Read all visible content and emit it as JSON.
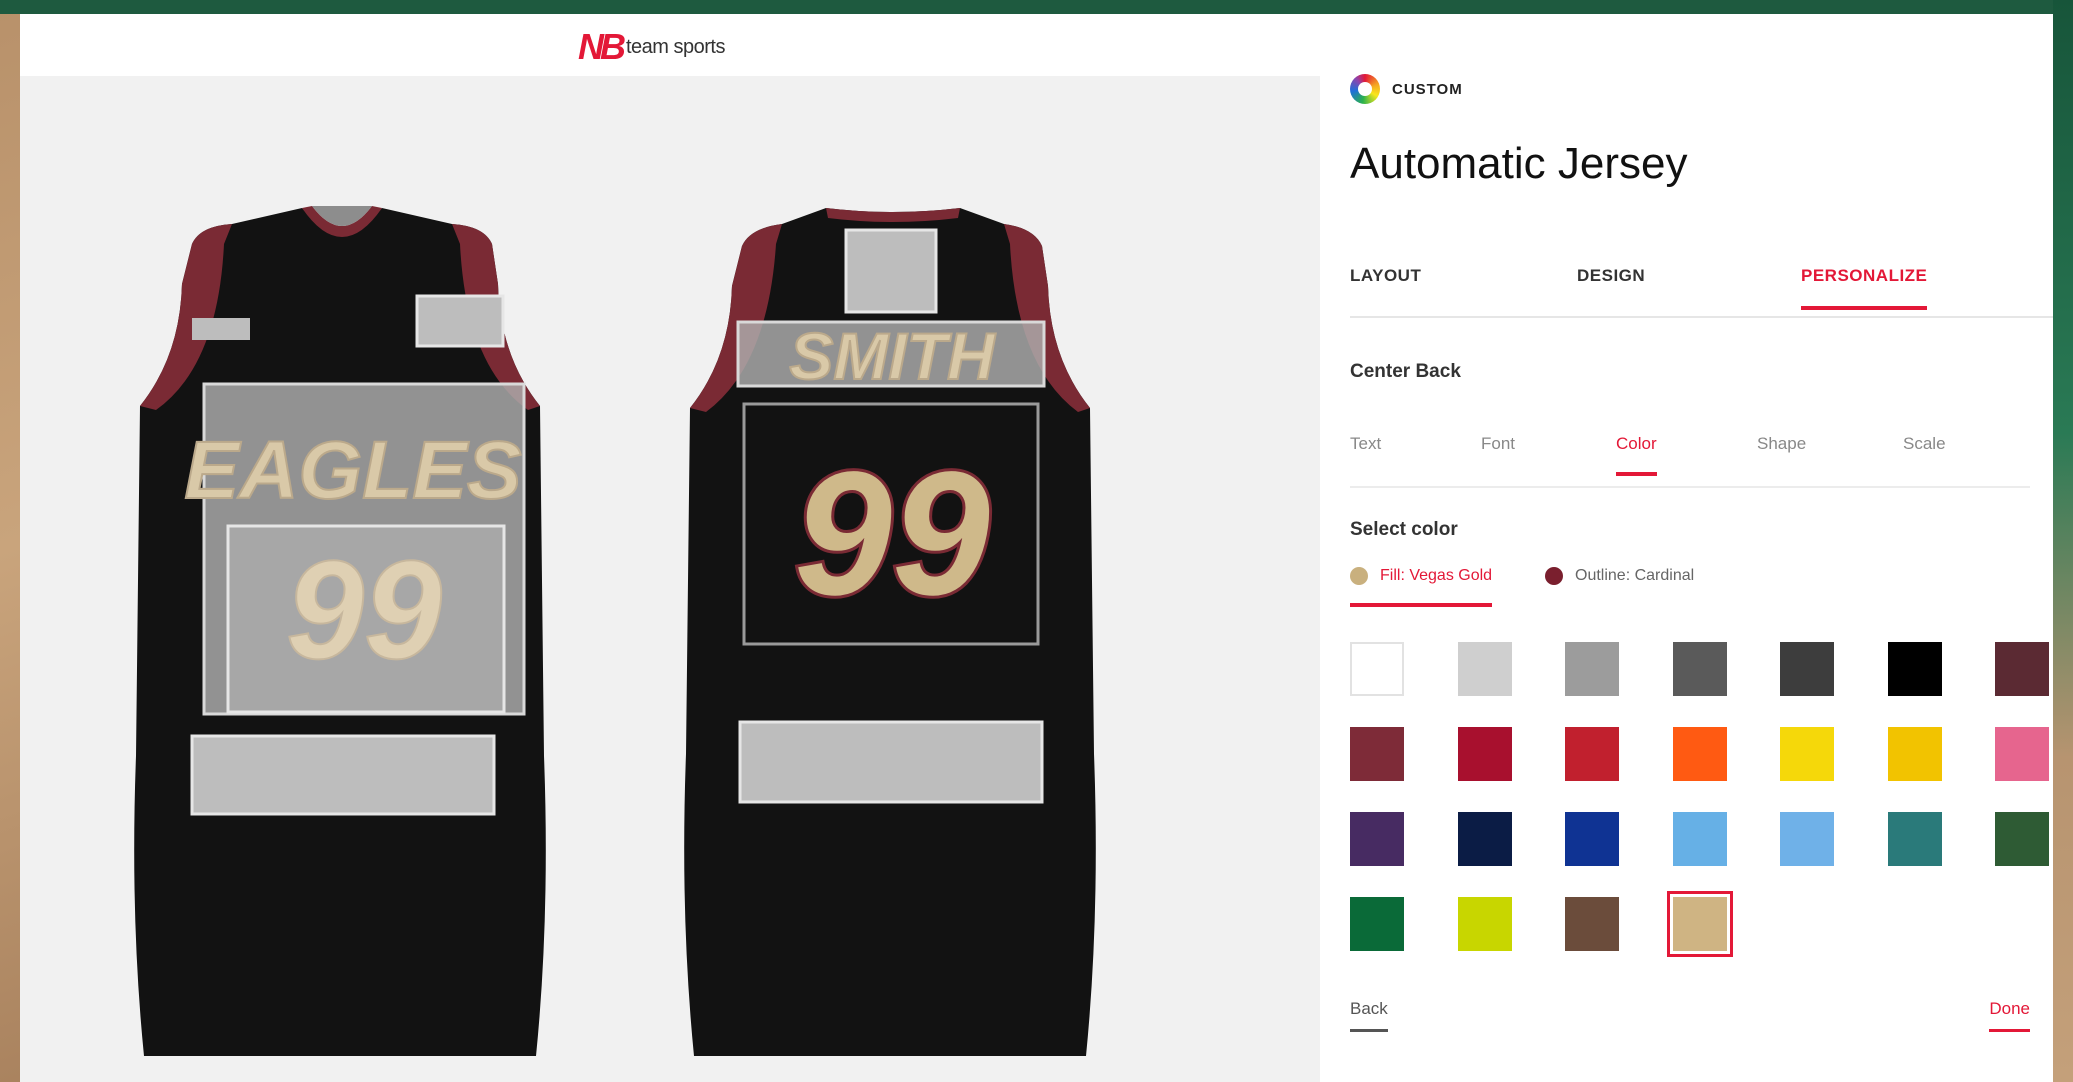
{
  "header": {
    "logo_mark": "NB",
    "logo_text": "team sports"
  },
  "preview": {
    "front": {
      "team_text": "EAGLES",
      "number": "99"
    },
    "back": {
      "name_text": "SMITH",
      "number": "99"
    },
    "colors": {
      "jersey": "#121212",
      "trim": "#7a2a34",
      "fill": "#cfb98a",
      "outline": "#7a2a34"
    }
  },
  "panel": {
    "brand_label": "CUSTOM",
    "title": "Automatic Jersey",
    "tabs": [
      {
        "label": "LAYOUT",
        "active": false
      },
      {
        "label": "DESIGN",
        "active": false
      },
      {
        "label": "PERSONALIZE",
        "active": true
      }
    ],
    "section_title": "Center Back",
    "subtabs": [
      {
        "label": "Text",
        "active": false
      },
      {
        "label": "Font",
        "active": false
      },
      {
        "label": "Color",
        "active": true
      },
      {
        "label": "Shape",
        "active": false
      },
      {
        "label": "Scale",
        "active": false
      }
    ],
    "select_color_title": "Select color",
    "fill": {
      "label": "Fill: Vegas Gold",
      "color": "#c9b07e"
    },
    "outline": {
      "label": "Outline: Cardinal",
      "color": "#7a1f2e"
    },
    "swatches": [
      "#ffffff",
      "#cfcfcf",
      "#9c9c9c",
      "#5a5a5a",
      "#3d3d3d",
      "#000000",
      "#5b2a33",
      "#7e2b38",
      "#a8102e",
      "#c1202e",
      "#ff5a12",
      "#f5d80a",
      "#f2c300",
      "#e6658e",
      "#472b62",
      "#0b1c45",
      "#0f3393",
      "#66b0e6",
      "#6fb1e8",
      "#2a7a7a",
      "#2e5b34",
      "#0a6a38",
      "#c8d600",
      "#6b4c3b",
      "#cfb483"
    ],
    "selected_swatch": 24,
    "footer": {
      "back": "Back",
      "done": "Done"
    }
  }
}
